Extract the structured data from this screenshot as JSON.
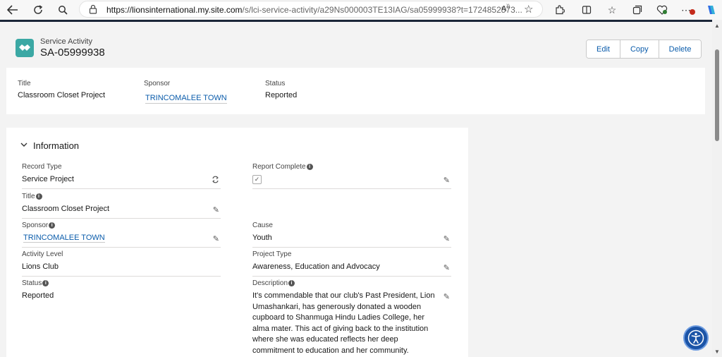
{
  "browser": {
    "url_host": "https://lionsinternational.my.site.com",
    "url_rest": "/s/lci-service-activity/a29Ns000003TE13IAG/sa05999938?t=1724852573..."
  },
  "record": {
    "object_label": "Service Activity",
    "name": "SA-05999938"
  },
  "actions": {
    "edit": "Edit",
    "copy": "Copy",
    "delete": "Delete"
  },
  "highlights": {
    "title_label": "Title",
    "title_value": "Classroom Closet Project",
    "sponsor_label": "Sponsor",
    "sponsor_value": "TRINCOMALEE TOWN",
    "status_label": "Status",
    "status_value": "Reported"
  },
  "information": {
    "heading": "Information",
    "record_type_label": "Record Type",
    "record_type_value": "Service Project",
    "report_complete_label": "Report Complete",
    "report_complete_checked": true,
    "title_label": "Title",
    "title_value": "Classroom Closet Project",
    "sponsor_label": "Sponsor",
    "sponsor_value": "TRINCOMALEE TOWN",
    "cause_label": "Cause",
    "cause_value": "Youth",
    "activity_level_label": "Activity Level",
    "activity_level_value": "Lions Club",
    "project_type_label": "Project Type",
    "project_type_value": "Awareness, Education and Advocacy",
    "status_label": "Status",
    "status_value": "Reported",
    "description_label": "Description",
    "description_lines": [
      "It's commendable that our club's Past President, Lion",
      "Umashankari, has generously donated a wooden",
      "cupboard to Shanmuga Hindu Ladies College, her",
      "alma mater. This act of giving back to the institution",
      "where she was educated reflects her deep",
      "commitment to education and her community."
    ]
  },
  "colors": {
    "brand_icon": "#3ba8a4",
    "link": "#0b5cab",
    "accessibility_button": "#1b54a7"
  },
  "icons": {
    "back": "arrow-left-icon",
    "reload": "reload-icon",
    "search": "search-icon",
    "site_info": "lock-icon",
    "read_aloud": "read-aloud-icon",
    "favorite": "star-icon",
    "extensions": "puzzle-icon",
    "split_screen": "split-screen-icon",
    "favorites": "favorites-icon",
    "collections": "collections-icon",
    "browser_essentials": "heart-pulse-icon",
    "more": "more-icon",
    "copilot": "copilot-icon",
    "record": "handshake-icon",
    "edit": "pencil-icon",
    "record_type": "change-record-type-icon",
    "info": "info-icon",
    "accessibility": "accessibility-icon"
  }
}
